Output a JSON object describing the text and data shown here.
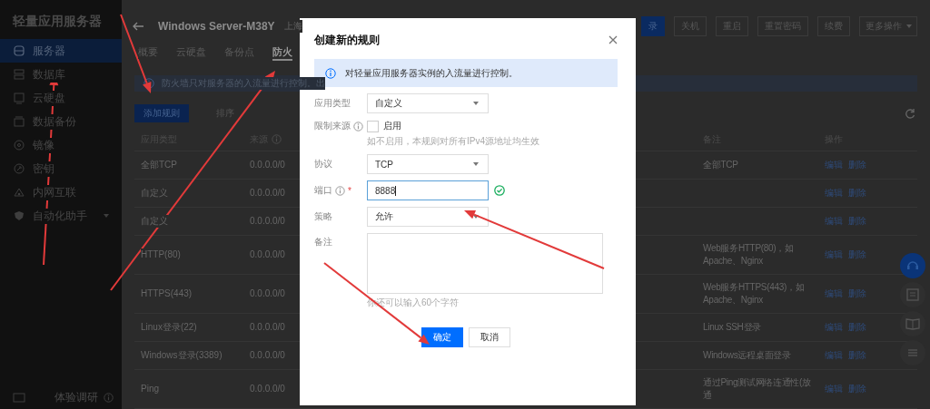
{
  "sidebar": {
    "title": "轻量应用服务器",
    "items": [
      {
        "label": "服务器",
        "selected": true,
        "expandable": false
      },
      {
        "label": "数据库",
        "selected": false,
        "expandable": false
      },
      {
        "label": "云硬盘",
        "selected": false,
        "expandable": false
      },
      {
        "label": "数据备份",
        "selected": false,
        "expandable": false
      },
      {
        "label": "镜像",
        "selected": false,
        "expandable": false
      },
      {
        "label": "密钥",
        "selected": false,
        "expandable": false
      },
      {
        "label": "内网互联",
        "selected": false,
        "expandable": false
      },
      {
        "label": "自动化助手",
        "selected": false,
        "expandable": true
      }
    ],
    "footer": "体验调研"
  },
  "header": {
    "title": "Windows Server-M38Y",
    "region": "上海",
    "login": "录",
    "actions": [
      "关机",
      "重启",
      "重置密码",
      "续费"
    ],
    "more": "更多操作"
  },
  "tabs": [
    {
      "label": "概要",
      "selected": false
    },
    {
      "label": "云硬盘",
      "selected": false
    },
    {
      "label": "备份点",
      "selected": false
    },
    {
      "label": "防火",
      "selected": true
    }
  ],
  "notice": "防火墙只对服务器的入流量进行控制。出",
  "toolbar": {
    "add": "添加规则",
    "sort": "排序"
  },
  "table": {
    "columns": [
      {
        "label": "应用类型"
      },
      {
        "label": "来源",
        "info": true
      },
      {
        "label": "备注"
      },
      {
        "label": "操作"
      }
    ],
    "rows": [
      {
        "type": "全部TCP",
        "source": "0.0.0.0/0",
        "note": "全部TCP",
        "actions": [
          "编辑",
          "删除"
        ]
      },
      {
        "type": "自定义",
        "source": "0.0.0.0/0",
        "actions": [
          "编辑",
          "删除"
        ]
      },
      {
        "type": "自定义",
        "source": "0.0.0.0/0",
        "actions": [
          "编辑",
          "删除"
        ]
      },
      {
        "type": "HTTP(80)",
        "source": "0.0.0.0/0",
        "note": "Web服务HTTP(80)，如Apache、Nginx",
        "actions": [
          "编辑",
          "删除"
        ]
      },
      {
        "type": "HTTPS(443)",
        "source": "0.0.0.0/0",
        "note": "Web服务HTTPS(443)，如Apache、Nginx",
        "actions": [
          "编辑",
          "删除"
        ]
      },
      {
        "type": "Linux登录(22)",
        "source": "0.0.0.0/0",
        "note": "Linux SSH登录",
        "actions": [
          "编辑",
          "删除"
        ]
      },
      {
        "type": "Windows登录(3389)",
        "source": "0.0.0.0/0",
        "note": "Windows远程桌面登录",
        "actions": [
          "编辑",
          "删除"
        ]
      },
      {
        "type": "Ping",
        "source": "0.0.0.0/0",
        "note": "通过Ping测试网络连通性(放通",
        "actions": [
          "编辑",
          "删除"
        ]
      }
    ]
  },
  "dialog": {
    "title": "创建新的规则",
    "alert": "对轻量应用服务器实例的入流量进行控制。",
    "fields": [
      {
        "kind": "select",
        "label": "应用类型",
        "value": "自定义"
      },
      {
        "kind": "checkbox",
        "label": "限制来源",
        "info": true,
        "option": "启用",
        "checked": false,
        "hint": "如不启用，本规则对所有IPv4源地址均生效"
      },
      {
        "kind": "select",
        "label": "协议",
        "value": "TCP"
      },
      {
        "kind": "input",
        "label": "端口",
        "info": true,
        "mark": "*",
        "value": "8888",
        "valid": true
      },
      {
        "kind": "select",
        "label": "策略",
        "value": "允许"
      },
      {
        "kind": "textarea",
        "label": "备注",
        "hint": "你还可以输入60个字符"
      }
    ],
    "buttons": [
      {
        "label": "确定",
        "primary": true
      },
      {
        "label": "取消",
        "primary": false
      }
    ]
  }
}
